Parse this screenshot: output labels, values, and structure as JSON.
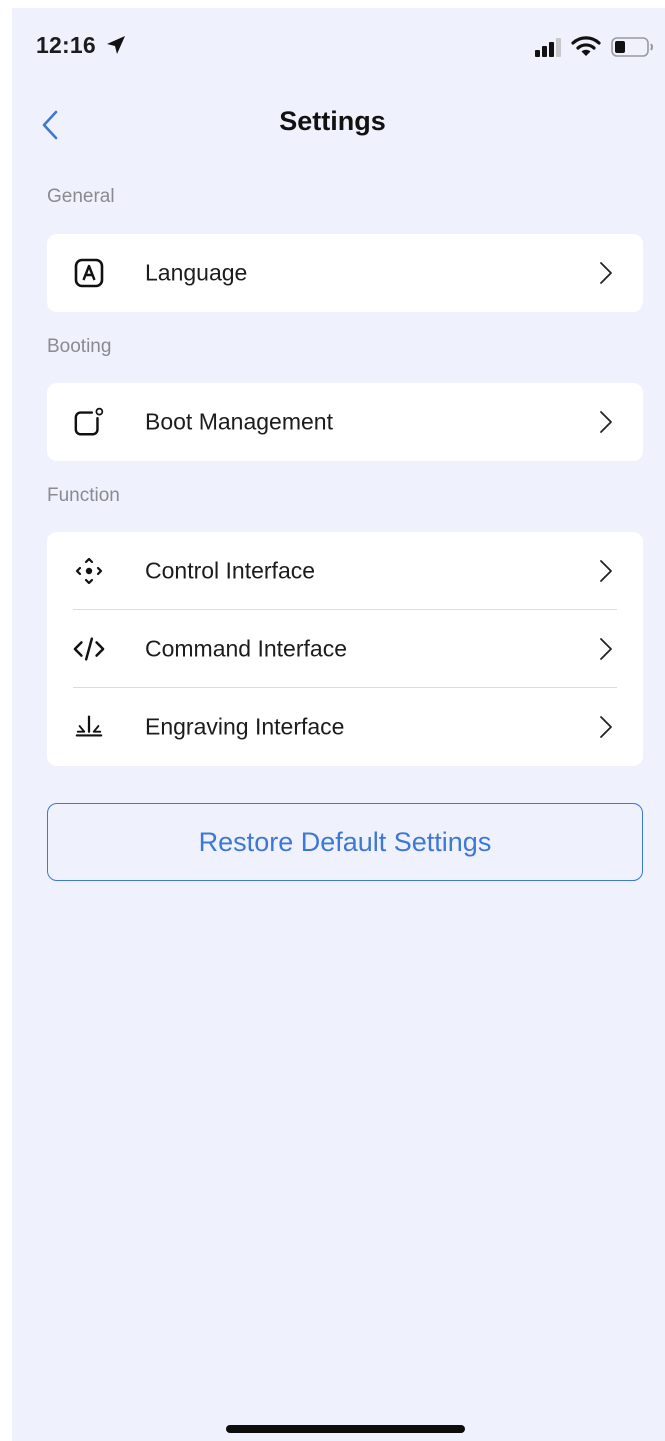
{
  "status_bar": {
    "time": "12:16"
  },
  "nav": {
    "title": "Settings"
  },
  "sections": {
    "general": {
      "label": "General",
      "items": [
        {
          "label": "Language",
          "icon": "language-icon"
        }
      ]
    },
    "booting": {
      "label": "Booting",
      "items": [
        {
          "label": "Boot Management",
          "icon": "boot-icon"
        }
      ]
    },
    "function": {
      "label": "Function",
      "items": [
        {
          "label": "Control Interface",
          "icon": "control-dpad-icon"
        },
        {
          "label": "Command Interface",
          "icon": "code-icon"
        },
        {
          "label": "Engraving Interface",
          "icon": "engraving-icon"
        }
      ]
    }
  },
  "actions": {
    "restore_label": "Restore Default Settings"
  },
  "colors": {
    "accent": "#3e78d6",
    "background": "#eff2fd",
    "card": "#ffffff",
    "section_label": "#8a8a90"
  }
}
